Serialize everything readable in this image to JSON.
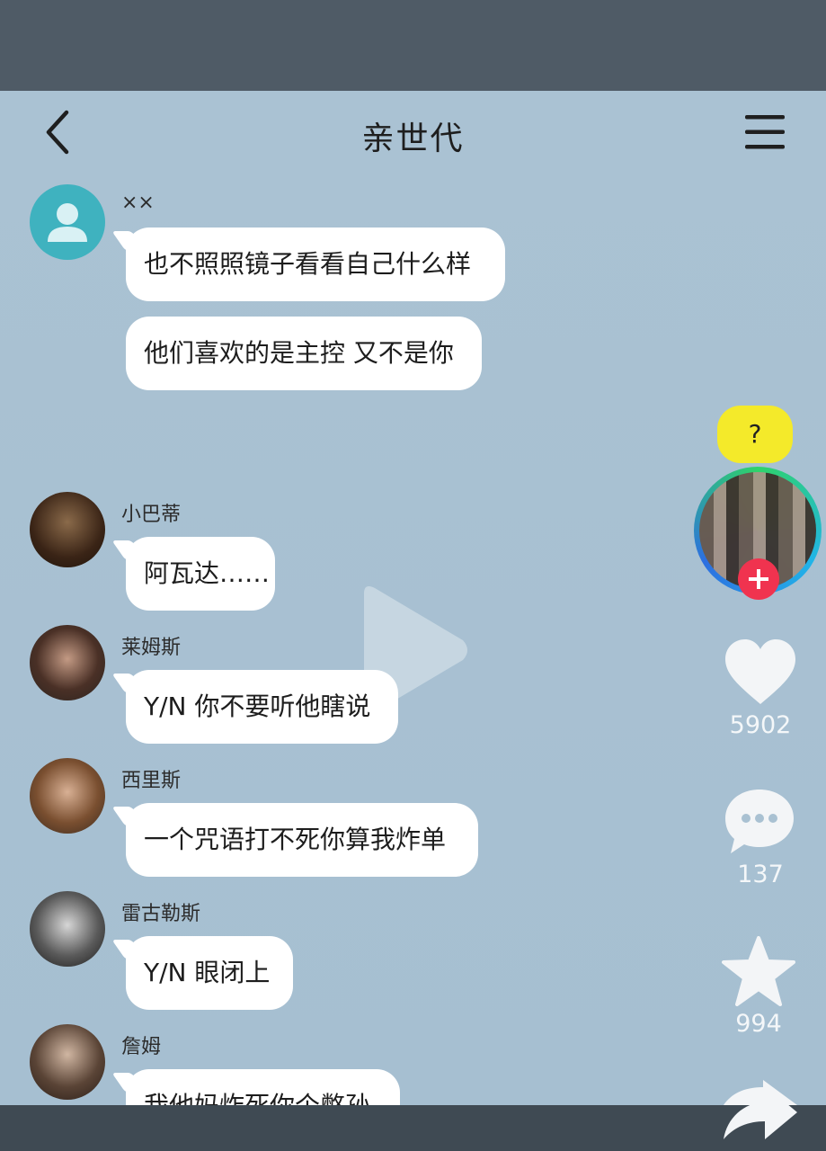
{
  "header": {
    "title": "亲世代"
  },
  "messages": [
    {
      "sender": "××",
      "bubbles": [
        "也不照照镜子看看自己什么样",
        "他们喜欢的是主控 又不是你"
      ]
    },
    {
      "sender": "小巴蒂",
      "bubbles": [
        "阿瓦达……"
      ]
    },
    {
      "sender": "莱姆斯",
      "bubbles": [
        "Y/N 你不要听他瞎说"
      ]
    },
    {
      "sender": "西里斯",
      "bubbles": [
        "一个咒语打不死你算我炸单"
      ]
    },
    {
      "sender": "雷古勒斯",
      "bubbles": [
        "Y/N 眼闭上"
      ]
    },
    {
      "sender": "詹姆",
      "bubbles": [
        "我他妈炸死你个憋孙"
      ]
    }
  ],
  "sidebar": {
    "question_bubble": "?",
    "likes": "5902",
    "comments": "137",
    "favorites": "994"
  },
  "colors": {
    "background": "#a9c1d2",
    "accent_red": "#f0334f"
  }
}
